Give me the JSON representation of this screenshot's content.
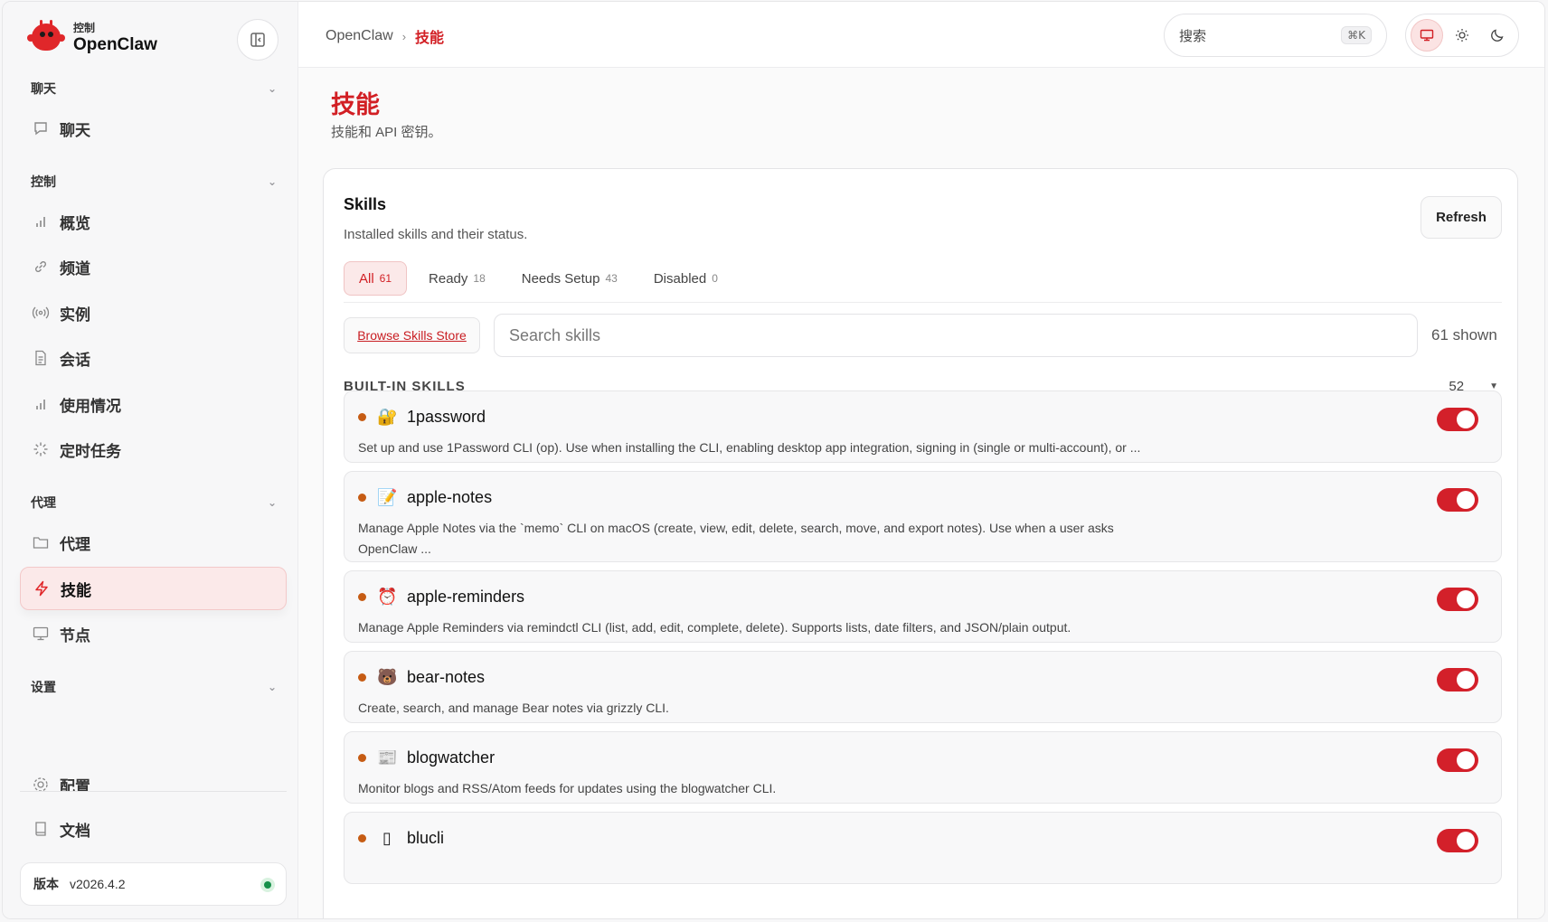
{
  "brand": {
    "sub": "控制",
    "name": "OpenClaw"
  },
  "sidebar": {
    "sections": [
      {
        "label": "聊天",
        "items": [
          {
            "label": "聊天",
            "icon": "chat-bubble-icon"
          }
        ]
      },
      {
        "label": "控制",
        "items": [
          {
            "label": "概览",
            "icon": "bar-chart-icon"
          },
          {
            "label": "频道",
            "icon": "link-icon"
          },
          {
            "label": "实例",
            "icon": "broadcast-icon"
          },
          {
            "label": "会话",
            "icon": "document-icon"
          },
          {
            "label": "使用情况",
            "icon": "bar-chart-icon"
          },
          {
            "label": "定时任务",
            "icon": "spinner-icon"
          }
        ]
      },
      {
        "label": "代理",
        "items": [
          {
            "label": "代理",
            "icon": "folder-icon"
          },
          {
            "label": "技能",
            "icon": "lightning-icon",
            "active": true
          },
          {
            "label": "节点",
            "icon": "monitor-icon"
          }
        ]
      },
      {
        "label": "设置",
        "items": [
          {
            "label": "配置",
            "icon": "gear-icon"
          }
        ]
      }
    ],
    "docs": {
      "label": "文档",
      "icon": "book-icon"
    },
    "version": {
      "label": "版本",
      "value": "v2026.4.2",
      "status_color": "#17904a"
    }
  },
  "topbar": {
    "breadcrumb": {
      "root": "OpenClaw",
      "separator": "›",
      "current": "技能"
    },
    "search": {
      "placeholder": "搜索",
      "shortcut": "⌘K"
    },
    "theme": [
      "monitor-icon",
      "sun-icon",
      "moon-icon"
    ]
  },
  "page": {
    "title": "技能",
    "subtitle": "技能和 API 密钥。"
  },
  "skills_card": {
    "title": "Skills",
    "subtitle": "Installed skills and their status.",
    "refresh_label": "Refresh",
    "tabs": [
      {
        "label": "All",
        "count": "61",
        "active": true
      },
      {
        "label": "Ready",
        "count": "18"
      },
      {
        "label": "Needs Setup",
        "count": "43"
      },
      {
        "label": "Disabled",
        "count": "0"
      }
    ],
    "store_label": "Browse Skills Store",
    "search_placeholder": "Search skills",
    "shown_text": "61 shown",
    "group": {
      "label": "BUILT-IN SKILLS",
      "count": "52"
    },
    "skills": [
      {
        "emoji": "🔐",
        "name": "1password",
        "desc": "Set up and use 1Password CLI (op). Use when installing the CLI, enabling desktop app integration, signing in (single or multi-account), or ...",
        "enabled": true
      },
      {
        "emoji": "📝",
        "name": "apple-notes",
        "desc": "Manage Apple Notes via the `memo` CLI on macOS (create, view, edit, delete, search, move, and export notes). Use when a user asks OpenClaw ...",
        "enabled": true
      },
      {
        "emoji": "⏰",
        "name": "apple-reminders",
        "desc": "Manage Apple Reminders via remindctl CLI (list, add, edit, complete, delete). Supports lists, date filters, and JSON/plain output.",
        "enabled": true
      },
      {
        "emoji": "🐻",
        "name": "bear-notes",
        "desc": "Create, search, and manage Bear notes via grizzly CLI.",
        "enabled": true
      },
      {
        "emoji": "📰",
        "name": "blogwatcher",
        "desc": "Monitor blogs and RSS/Atom feeds for updates using the blogwatcher CLI.",
        "enabled": true
      },
      {
        "emoji": "▯",
        "name": "blucli",
        "desc": "",
        "enabled": true
      }
    ]
  },
  "colors": {
    "accent": "#d21f24",
    "status_dot": "#c65c14",
    "toggle_on": "#d3202a"
  }
}
